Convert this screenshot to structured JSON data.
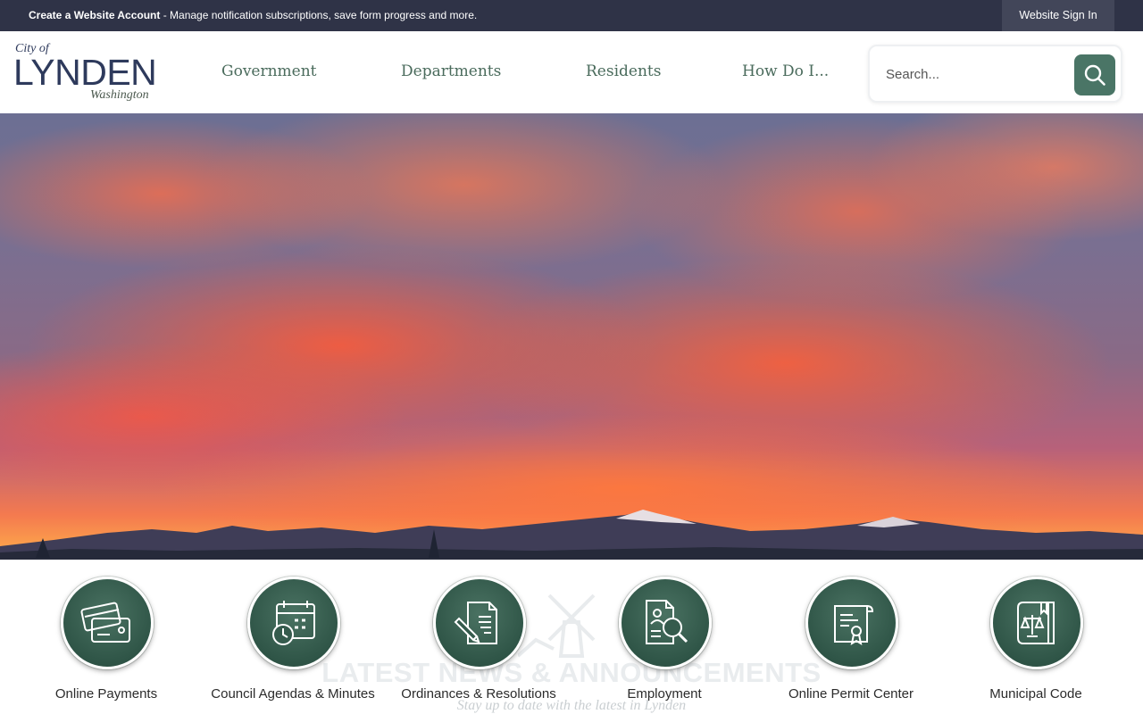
{
  "topbar": {
    "create_link": "Create a Website Account",
    "message": " - Manage notification subscriptions, save form progress and more.",
    "signin_label": "Website Sign In"
  },
  "logo": {
    "city_of": "City of",
    "name": "LYNDEN",
    "state": "Washington"
  },
  "nav": {
    "items": [
      "Government",
      "Departments",
      "Residents",
      "How Do I..."
    ]
  },
  "search": {
    "placeholder": "Search..."
  },
  "quick_links": {
    "items": [
      {
        "label": "Online Payments",
        "icon": "credit-card-icon"
      },
      {
        "label": "Council Agendas & Minutes",
        "icon": "calendar-clock-icon"
      },
      {
        "label": "Ordinances & Resolutions",
        "icon": "document-pen-icon"
      },
      {
        "label": "Employment",
        "icon": "resume-search-icon"
      },
      {
        "label": "Online Permit Center",
        "icon": "certificate-icon"
      },
      {
        "label": "Municipal Code",
        "icon": "law-book-icon"
      }
    ]
  },
  "news": {
    "title": "LATEST NEWS & ANNOUNCEMENTS",
    "subtitle": "Stay up to date with the latest in Lynden"
  },
  "colors": {
    "topbar": "#2f3347",
    "accent_green": "#4a7566",
    "nav_text": "#4a6b5c"
  }
}
